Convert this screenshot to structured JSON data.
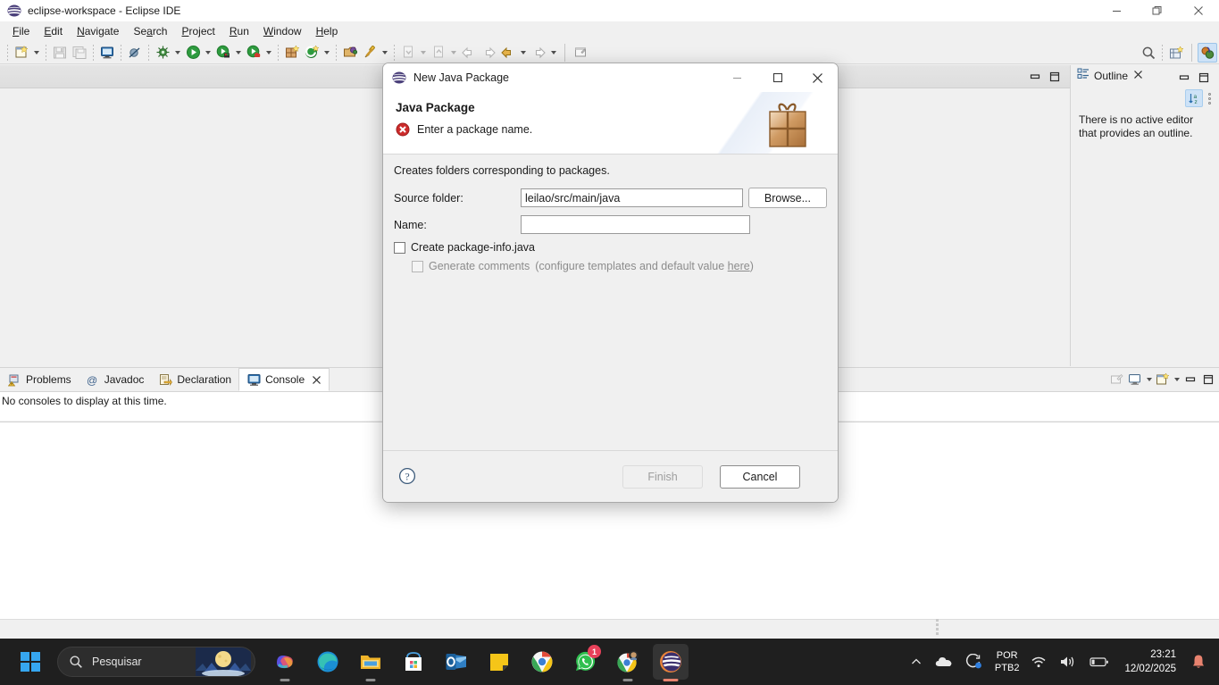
{
  "window": {
    "title": "eclipse-workspace - Eclipse IDE",
    "app_icon": "eclipse-icon",
    "controls": {
      "minimize": "minimize-icon",
      "restore": "restore-icon",
      "close": "close-icon"
    }
  },
  "menubar": {
    "items": [
      {
        "label": "File",
        "mnemonic": "F"
      },
      {
        "label": "Edit",
        "mnemonic": "E"
      },
      {
        "label": "Navigate",
        "mnemonic": "N"
      },
      {
        "label": "Search",
        "mnemonic": "a"
      },
      {
        "label": "Project",
        "mnemonic": "P"
      },
      {
        "label": "Run",
        "mnemonic": "R"
      },
      {
        "label": "Window",
        "mnemonic": "W"
      },
      {
        "label": "Help",
        "mnemonic": "H"
      }
    ]
  },
  "toolbar": {
    "items": [
      "new-wizard-icon",
      "save-icon",
      "save-all-icon",
      "new-java-console-icon",
      "skip-breakpoints-icon",
      "debug-icon",
      "run-icon",
      "run-coverage-icon",
      "profile-icon",
      "new-package-icon",
      "external-tools-icon",
      "open-type-icon",
      "open-task-icon",
      "previous-annotation-icon",
      "next-annotation-icon",
      "back-icon",
      "forward-icon",
      "pin-editor-icon"
    ],
    "right_items": [
      "search-icon",
      "new-perspective-icon",
      "java-perspective-icon"
    ]
  },
  "editor_area": {
    "controls": [
      "minimize-icon",
      "maximize-icon"
    ]
  },
  "outline": {
    "tab_label": "Outline",
    "tab_icon": "outline-icon",
    "close_icon": "close-icon",
    "view_controls": [
      "minimize-icon",
      "maximize-icon"
    ],
    "sort_icon": "sort-az-icon",
    "menu_icon": "view-menu-icon",
    "message": "There is no active editor that provides an outline."
  },
  "bottom_panel": {
    "tabs": [
      {
        "label": "Problems",
        "icon": "problems-icon",
        "selected": false,
        "closable": false
      },
      {
        "label": "Javadoc",
        "icon": "javadoc-icon",
        "selected": false,
        "closable": false
      },
      {
        "label": "Declaration",
        "icon": "declaration-icon",
        "selected": false,
        "closable": false
      },
      {
        "label": "Console",
        "icon": "console-icon",
        "selected": true,
        "closable": true
      }
    ],
    "toolbar_icons": [
      "clear-console-icon",
      "display-selected-console-icon",
      "open-console-icon"
    ],
    "view_controls": [
      "minimize-icon",
      "maximize-icon"
    ],
    "content_message": "No consoles to display at this time."
  },
  "dialog": {
    "title": "New Java Package",
    "title_icon": "eclipse-icon",
    "controls": {
      "minimize": "minimize-icon",
      "maximize": "maximize-icon",
      "close": "close-icon"
    },
    "heading": "Java Package",
    "status_icon": "error-icon",
    "status_message": "Enter a package name.",
    "banner_icon": "gift-box-icon",
    "description": "Creates folders corresponding to packages.",
    "fields": {
      "source_folder": {
        "label": "Source folder:",
        "value": "leilao/src/main/java",
        "placeholder": ""
      },
      "name": {
        "label": "Name:",
        "value": "",
        "placeholder": ""
      }
    },
    "browse_button": "Browse...",
    "create_package_info": {
      "label": "Create package-info.java",
      "checked": false
    },
    "generate_comments": {
      "label": "Generate comments",
      "hint_prefix": "(configure templates and default value ",
      "hint_link": "here",
      "hint_suffix": ")",
      "checked": false,
      "enabled": false
    },
    "footer": {
      "help_icon": "help-icon",
      "finish_button": "Finish",
      "finish_enabled": false,
      "cancel_button": "Cancel"
    }
  },
  "taskbar": {
    "start_icon": "windows-start-icon",
    "search": {
      "placeholder": "Pesquisar",
      "icon": "search-icon",
      "illustration": "moon-illustration"
    },
    "apps": [
      {
        "name": "copilot-icon",
        "running": true,
        "active": false,
        "badge": ""
      },
      {
        "name": "edge-icon",
        "running": false,
        "active": false,
        "badge": ""
      },
      {
        "name": "file-explorer-icon",
        "running": true,
        "active": false,
        "badge": ""
      },
      {
        "name": "microsoft-store-icon",
        "running": false,
        "active": false,
        "badge": ""
      },
      {
        "name": "outlook-icon",
        "running": false,
        "active": false,
        "badge": ""
      },
      {
        "name": "sticky-notes-icon",
        "running": false,
        "active": false,
        "badge": ""
      },
      {
        "name": "chrome-icon",
        "running": false,
        "active": false,
        "badge": ""
      },
      {
        "name": "whatsapp-icon",
        "running": false,
        "active": false,
        "badge": "1"
      },
      {
        "name": "chrome-profile-icon",
        "running": true,
        "active": false,
        "badge": ""
      },
      {
        "name": "eclipse-icon",
        "running": true,
        "active": true,
        "badge": ""
      }
    ],
    "tray": {
      "overflow_icon": "chevron-up-icon",
      "onedrive_icon": "onedrive-icon",
      "sync_icon": "sync-icon",
      "language": {
        "line1": "POR",
        "line2": "PTB2"
      },
      "wifi_icon": "wifi-icon",
      "volume_icon": "volume-icon",
      "battery_icon": "battery-icon",
      "clock": {
        "time": "23:21",
        "date": "12/02/2025"
      },
      "notification_icon": "bell-icon"
    }
  },
  "colors": {
    "accent": "#0078d4",
    "error": "#cc2b2b",
    "taskbar_bg": "#1f1f1f",
    "panel_bg": "#f0f0f0"
  }
}
